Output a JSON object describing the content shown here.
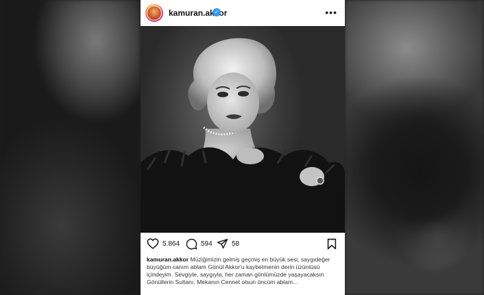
{
  "post": {
    "username": "kamuran.akkor",
    "verified_mark": "✓",
    "more_icon": "•••",
    "likes": "5.864",
    "comments": "594",
    "shares": "58",
    "caption": "Müziğimizin gelmiş geçmiş en büyük sesi, saygıdeğer büyüğüm canım ablam Gönül Akkor'u kaybetmenin derin üzüntüsü içindeyim. Sevgiyle, saygıyla, her zaman gönlümüzde yaşayacaksın Gönüllerin Sultanı. Mekanın Cennet olsun öncüm ablam..."
  },
  "icons": {
    "like": "heart-icon",
    "comment": "comment-bubble-icon",
    "share": "paper-plane-icon",
    "save": "bookmark-icon",
    "verified": "verified-badge-icon",
    "more": "more-options-icon"
  },
  "colors": {
    "verified": "#3897f0",
    "text": "#111111"
  }
}
